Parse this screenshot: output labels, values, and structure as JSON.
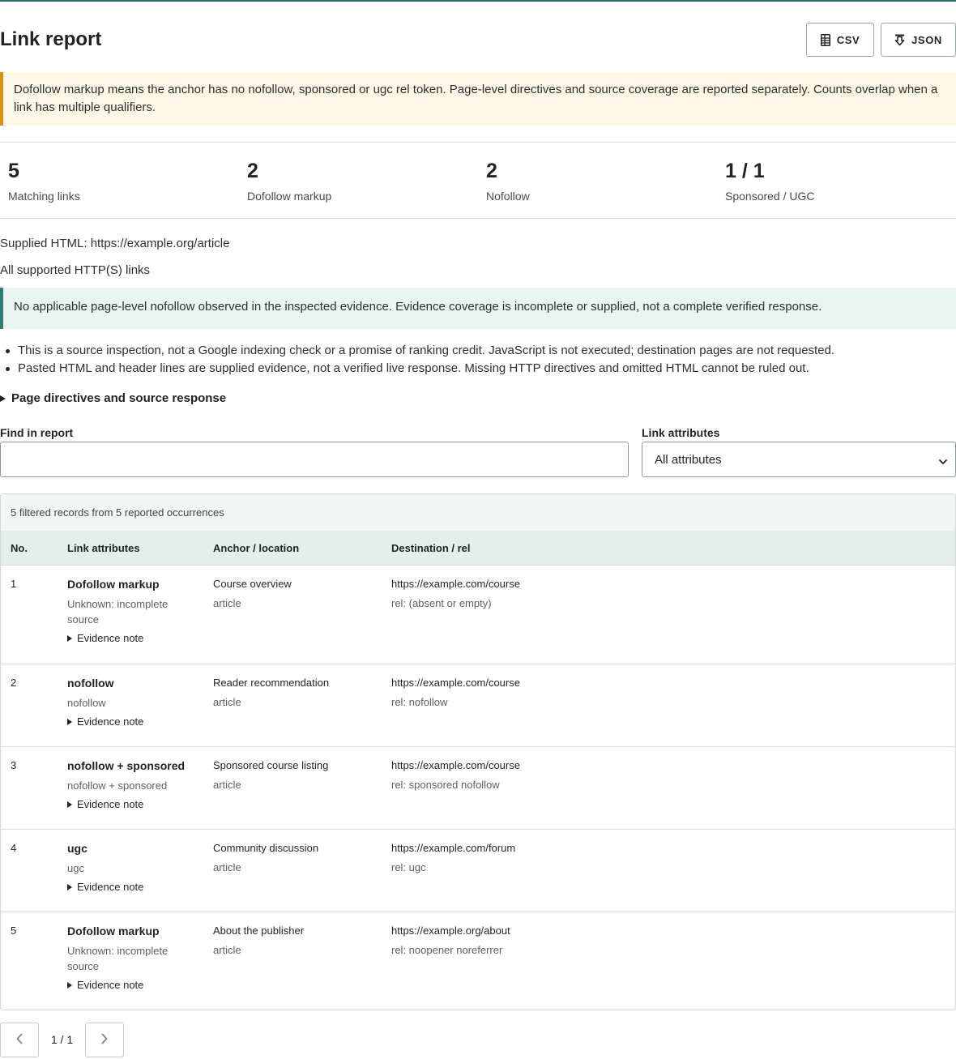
{
  "header": {
    "title": "Link report",
    "csv_label": "CSV",
    "json_label": "JSON",
    "csv_icon": "spreadsheet-icon",
    "json_icon": "download-icon"
  },
  "notice": {
    "text": "Dofollow markup means the anchor has no nofollow, sponsored or ugc rel token. Page-level directives and source coverage are reported separately. Counts overlap when a link has multiple qualifiers.",
    "accent_color": "#d9920f"
  },
  "stats": [
    {
      "value": "5",
      "label": "Matching links"
    },
    {
      "value": "2",
      "label": "Dofollow markup"
    },
    {
      "value": "2",
      "label": "Nofollow"
    },
    {
      "value": "1 / 1",
      "label": "Sponsored / UGC"
    }
  ],
  "source": {
    "supplied_html": "Supplied HTML: https://example.org/article",
    "scope": "All supported HTTP(S) links"
  },
  "evidence": {
    "text": "No applicable page-level nofollow observed in the inspected evidence. Evidence coverage is incomplete or supplied, not a complete verified response.",
    "accent_color": "#2f7d72"
  },
  "bullets": [
    "This is a source inspection, not a Google indexing check or a promise of ranking credit. JavaScript is not executed; destination pages are not requested.",
    "Pasted HTML and header lines are supplied evidence, not a verified live response. Missing HTTP directives and omitted HTML cannot be ruled out."
  ],
  "details_summary": "Page directives and source response",
  "filters": {
    "find_label": "Find in report",
    "find_value": "",
    "attr_label": "Link attributes",
    "attr_selected": "All attributes"
  },
  "table": {
    "caption": "5 filtered records from 5 reported occurrences",
    "columns": [
      "No.",
      "Link attributes",
      "Anchor / location",
      "Destination / rel"
    ],
    "evidence_label": "Evidence note",
    "rows": [
      {
        "no": "1",
        "attr": "Dofollow markup",
        "attr_sub": "Unknown: incomplete source",
        "anchor": "Course overview",
        "location": "article",
        "dest": "https://example.com/course",
        "rel": "rel: (absent or empty)"
      },
      {
        "no": "2",
        "attr": "nofollow",
        "attr_sub": "nofollow",
        "anchor": "Reader recommendation",
        "location": "article",
        "dest": "https://example.com/course",
        "rel": "rel: nofollow"
      },
      {
        "no": "3",
        "attr": "nofollow + sponsored",
        "attr_sub": "nofollow + sponsored",
        "anchor": "Sponsored course listing",
        "location": "article",
        "dest": "https://example.com/course",
        "rel": "rel: sponsored nofollow"
      },
      {
        "no": "4",
        "attr": "ugc",
        "attr_sub": "ugc",
        "anchor": "Community discussion",
        "location": "article",
        "dest": "https://example.com/forum",
        "rel": "rel: ugc"
      },
      {
        "no": "5",
        "attr": "Dofollow markup",
        "attr_sub": "Unknown: incomplete source",
        "anchor": "About the publisher",
        "location": "article",
        "dest": "https://example.org/about",
        "rel": "rel: noopener noreferrer"
      }
    ]
  },
  "pager": {
    "label": "1 / 1",
    "prev_icon": "chevron-left-icon",
    "next_icon": "chevron-right-icon"
  }
}
